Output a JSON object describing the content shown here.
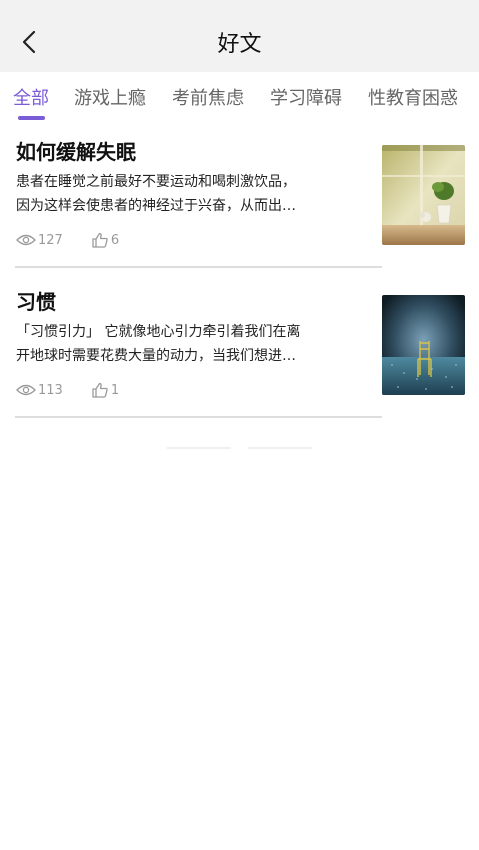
{
  "header": {
    "title": "好文",
    "back_icon": "chevron-left-icon"
  },
  "tabs": [
    {
      "label": "全部",
      "active": true
    },
    {
      "label": "游戏上瘾",
      "active": false
    },
    {
      "label": "考前焦虑",
      "active": false
    },
    {
      "label": "学习障碍",
      "active": false
    },
    {
      "label": "性教育困惑",
      "active": false
    }
  ],
  "articles": [
    {
      "title": "如何缓解失眠",
      "snippet_line1": "患者在睡觉之前最好不要运动和喝刺激饮品，",
      "snippet_line2": "因为这样会使患者的神经过于兴奋，从而出…",
      "views": "127",
      "likes": "6",
      "thumbnail": "plant-by-window-photo"
    },
    {
      "title": "习惯",
      "snippet_line1": "「习惯引力」 它就像地心引力牵引着我们在离",
      "snippet_line2": "开地球时需要花费大量的动力，当我们想进…",
      "views": "113",
      "likes": "1",
      "thumbnail": "chair-in-field-photo"
    }
  ],
  "colors": {
    "accent": "#7a5cd6",
    "header_bg": "#f2f2f2",
    "meta_text": "#9a9a9a",
    "divider": "#dddddd"
  }
}
